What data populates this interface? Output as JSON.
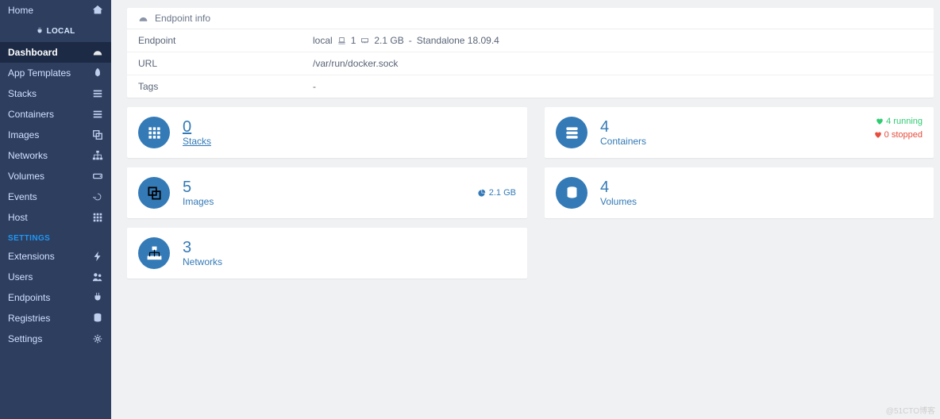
{
  "sidebar": {
    "home": "Home",
    "env": "LOCAL",
    "items": [
      {
        "label": "Dashboard",
        "active": true,
        "icon": "tachometer"
      },
      {
        "label": "App Templates",
        "icon": "rocket"
      },
      {
        "label": "Stacks",
        "icon": "list"
      },
      {
        "label": "Containers",
        "icon": "list"
      },
      {
        "label": "Images",
        "icon": "clone"
      },
      {
        "label": "Networks",
        "icon": "sitemap"
      },
      {
        "label": "Volumes",
        "icon": "hdd"
      },
      {
        "label": "Events",
        "icon": "history"
      },
      {
        "label": "Host",
        "icon": "th"
      }
    ],
    "settings_header": "SETTINGS",
    "settings": [
      {
        "label": "Extensions",
        "icon": "bolt"
      },
      {
        "label": "Users",
        "icon": "users"
      },
      {
        "label": "Endpoints",
        "icon": "plug"
      },
      {
        "label": "Registries",
        "icon": "database"
      },
      {
        "label": "Settings",
        "icon": "cogs"
      }
    ]
  },
  "endpoint_panel": {
    "title": "Endpoint info",
    "rows": {
      "endpoint_label": "Endpoint",
      "endpoint_name": "local",
      "cpu": "1",
      "ram": "2.1 GB",
      "mode": "Standalone 18.09.4",
      "url_label": "URL",
      "url_value": "/var/run/docker.sock",
      "tags_label": "Tags",
      "tags_value": "-"
    }
  },
  "tiles": {
    "stacks": {
      "count": "0",
      "label": "Stacks"
    },
    "images": {
      "count": "5",
      "label": "Images",
      "size": "2.1 GB"
    },
    "networks": {
      "count": "3",
      "label": "Networks"
    },
    "containers": {
      "count": "4",
      "label": "Containers",
      "running": "4 running",
      "stopped": "0 stopped"
    },
    "volumes": {
      "count": "4",
      "label": "Volumes"
    }
  },
  "watermark": "@51CTO博客"
}
